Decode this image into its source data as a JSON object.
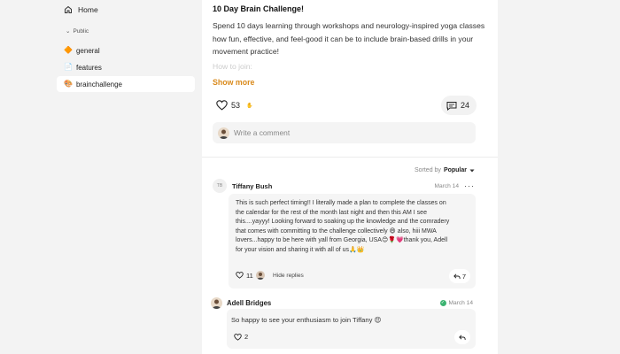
{
  "sidebar": {
    "home_label": "Home",
    "section_label": "Public",
    "channels": [
      {
        "emoji": "🔶",
        "label": "general"
      },
      {
        "emoji": "📄",
        "label": "features"
      },
      {
        "emoji": "🎨",
        "label": "brainchallenge"
      }
    ]
  },
  "post": {
    "title": "10 Day Brain Challenge!",
    "body": "Spend 10 days learning through workshops and neurology-inspired yoga classes how fun, effective, and feel-good it can be to include brain-based drills in your movement practice!",
    "faded_text": "How to join:",
    "show_more": "Show more",
    "likes": "53",
    "likes_note": "✋",
    "comments": "24",
    "write_placeholder": "Write a comment"
  },
  "sort": {
    "prefix": "Sorted by",
    "value": "Popular"
  },
  "comments": [
    {
      "avatar_initials": "TB",
      "author": "Tiffany Bush",
      "date": "March 14",
      "more": "···",
      "text": "This is such perfect timing!! I literally made a plan to complete the classes on the calendar for the rest of the month last night and then this AM I see this....yayyy! Looking forward to soaking up the knowledge and the comradery that comes with committing to the challenge collectively 😄 also, hiii MWA lovers...happy to be here with yall from Georgia, USA😊🌹💗thank you, Adell for your vision and sharing it with all of us🙏👑",
      "likes": "11",
      "hide_replies": "Hide replies",
      "replies": "7"
    },
    {
      "author": "Adell Bridges",
      "date": "March 14",
      "verified": "✓",
      "text": "So happy to see your enthusiasm to join Tiffany 😍",
      "likes": "2"
    }
  ],
  "colors": {
    "accent": "#d98a1c",
    "verified": "#3cb371",
    "sidebar_bg": "#f3f3f3"
  }
}
